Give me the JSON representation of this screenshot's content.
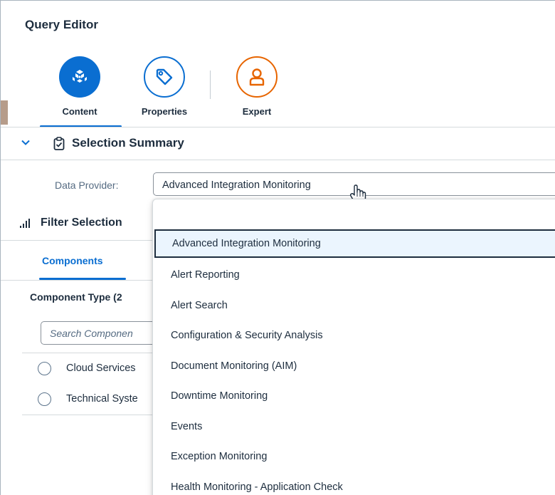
{
  "window": {
    "title": "Query Editor"
  },
  "toolbar": {
    "items": [
      {
        "label": "Content",
        "icon": "cube-icon",
        "active": true
      },
      {
        "label": "Properties",
        "icon": "tag-icon"
      },
      {
        "label": "Expert",
        "icon": "person-icon"
      }
    ]
  },
  "selection_summary": {
    "title": "Selection Summary",
    "data_provider_label": "Data Provider:",
    "data_provider_value": "Advanced Integration Monitoring"
  },
  "filter_selection": {
    "title": "Filter Selection",
    "tab": "Components",
    "component_type_label": "Component Type (2",
    "search_placeholder": "Search Componen",
    "items": [
      "Cloud Services",
      "Technical Syste"
    ]
  },
  "dropdown": {
    "options": [
      "Advanced Integration Monitoring",
      "Alert Reporting",
      "Alert Search",
      "Configuration & Security Analysis",
      "Document Monitoring (AIM)",
      "Downtime Monitoring",
      "Events",
      "Exception Monitoring",
      "Health Monitoring - Application Check"
    ],
    "selected": "Advanced Integration Monitoring"
  },
  "colors": {
    "accent": "#0a6ed1",
    "expert": "#e76500",
    "text": "#1d2d3e"
  }
}
